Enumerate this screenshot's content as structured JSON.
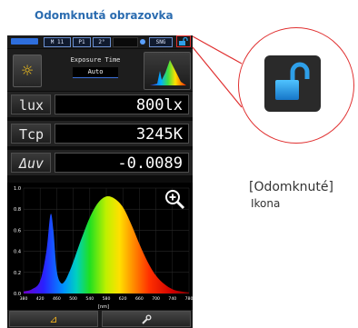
{
  "heading": "Odomknutá obrazovka",
  "status_bar": {
    "mode": "M 11",
    "preset": "P1",
    "angle": "2°",
    "measure": "SNG",
    "lock_icon": "unlock-icon"
  },
  "exposure": {
    "label": "Exposure Time",
    "value": "Auto"
  },
  "readouts": [
    {
      "label": "lux",
      "value": "800lx"
    },
    {
      "label": "Tcp",
      "value": "3245K"
    },
    {
      "label": "Δuv",
      "value": "-0.0089"
    }
  ],
  "spectrum": {
    "y_ticks": [
      "1.0",
      "0.8",
      "0.6",
      "0.4",
      "0.2",
      "0.0"
    ],
    "x_ticks": [
      "380",
      "420",
      "460",
      "500",
      "540",
      "580",
      "620",
      "660",
      "700",
      "740",
      "780"
    ],
    "x_unit": "[nm]"
  },
  "bottom_bar": {
    "left_icon": "delta-icon",
    "right_icon": "wrench-icon",
    "left_label": "⊿"
  },
  "callout": {
    "caption_line1": "[Odomknuté]",
    "caption_line2": "Ikona"
  },
  "colors": {
    "heading": "#2b6cb0",
    "highlight": "#e03030",
    "lock_blue": "#2e9fe8"
  },
  "chart_data": {
    "type": "area",
    "x": [
      380,
      400,
      420,
      435,
      445,
      452,
      460,
      470,
      480,
      490,
      500,
      520,
      540,
      560,
      580,
      600,
      620,
      640,
      660,
      680,
      700,
      720,
      740,
      760,
      780
    ],
    "values": [
      0.02,
      0.04,
      0.12,
      0.4,
      0.75,
      0.6,
      0.22,
      0.1,
      0.12,
      0.2,
      0.3,
      0.52,
      0.72,
      0.86,
      0.92,
      0.9,
      0.82,
      0.66,
      0.47,
      0.3,
      0.17,
      0.09,
      0.04,
      0.02,
      0.01
    ],
    "xlim": [
      380,
      780
    ],
    "ylim": [
      0,
      1.0
    ],
    "xlabel": "[nm]",
    "ylabel": ""
  }
}
